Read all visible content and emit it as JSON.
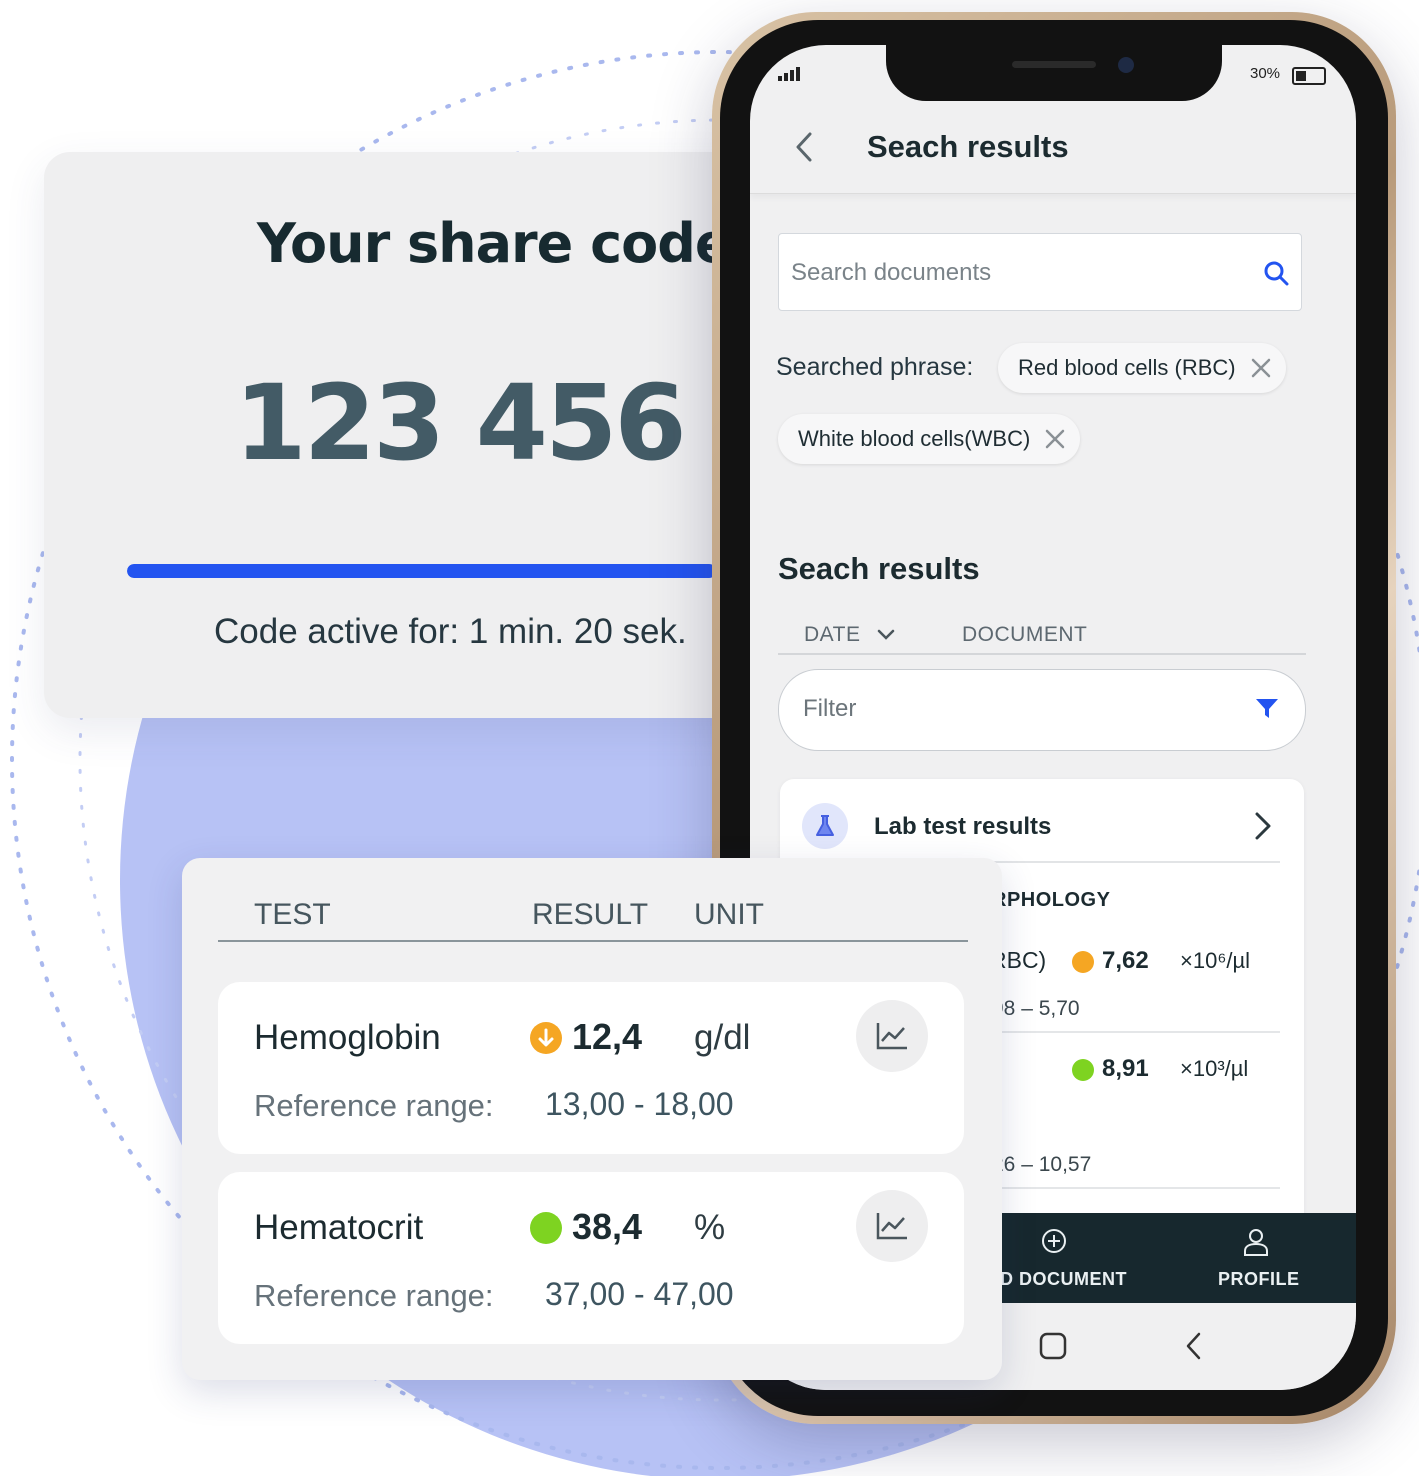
{
  "share": {
    "title": "Your share code:",
    "code": "123 456",
    "progress": 0.92,
    "active_text": "Code active for: 1 min. 20 sek."
  },
  "phone": {
    "status": {
      "battery": "30%"
    },
    "app_bar": {
      "title": "Seach results"
    },
    "search": {
      "placeholder": "Search documents"
    },
    "phrase_label": "Searched phrase:",
    "chips": [
      "Red blood cells (RBC)",
      "White blood cells(WBC)"
    ],
    "results_title": "Seach results",
    "columns": {
      "date": "DATE",
      "document": "DOCUMENT"
    },
    "filter": {
      "placeholder": "Filter"
    },
    "lab_card": {
      "title": "Lab test results",
      "section": "RPHOLOGY",
      "rows": [
        {
          "name": "RBC)",
          "value": "7,62",
          "unit": "×10⁶/µl",
          "ref": "98 – 5,70",
          "status_color": "#f5a623"
        },
        {
          "name": "",
          "value": "8,91",
          "unit": "×10³/µl",
          "ref": "26 – 10,57",
          "status_color": "#7ed321"
        }
      ]
    },
    "bottom_nav": [
      {
        "label": "D DOCUMENT",
        "icon": "plus-circle-icon"
      },
      {
        "label": "PROFILE",
        "icon": "person-icon"
      }
    ]
  },
  "table": {
    "headers": {
      "test": "TEST",
      "result": "RESULT",
      "unit": "UNIT"
    },
    "ref_label": "Reference range:",
    "rows": [
      {
        "name": "Hemoglobin",
        "value": "12,4",
        "unit": "g/dl",
        "ref": "13,00 - 18,00",
        "status": "low",
        "status_color": "#f5a623"
      },
      {
        "name": "Hematocrit",
        "value": "38,4",
        "unit": "%",
        "ref": "37,00 - 47,00",
        "status": "normal",
        "status_color": "#7ed321"
      }
    ]
  },
  "colors": {
    "accent": "#2354f0",
    "blob": "#b9c4f7",
    "nav_dark": "#17282e"
  }
}
